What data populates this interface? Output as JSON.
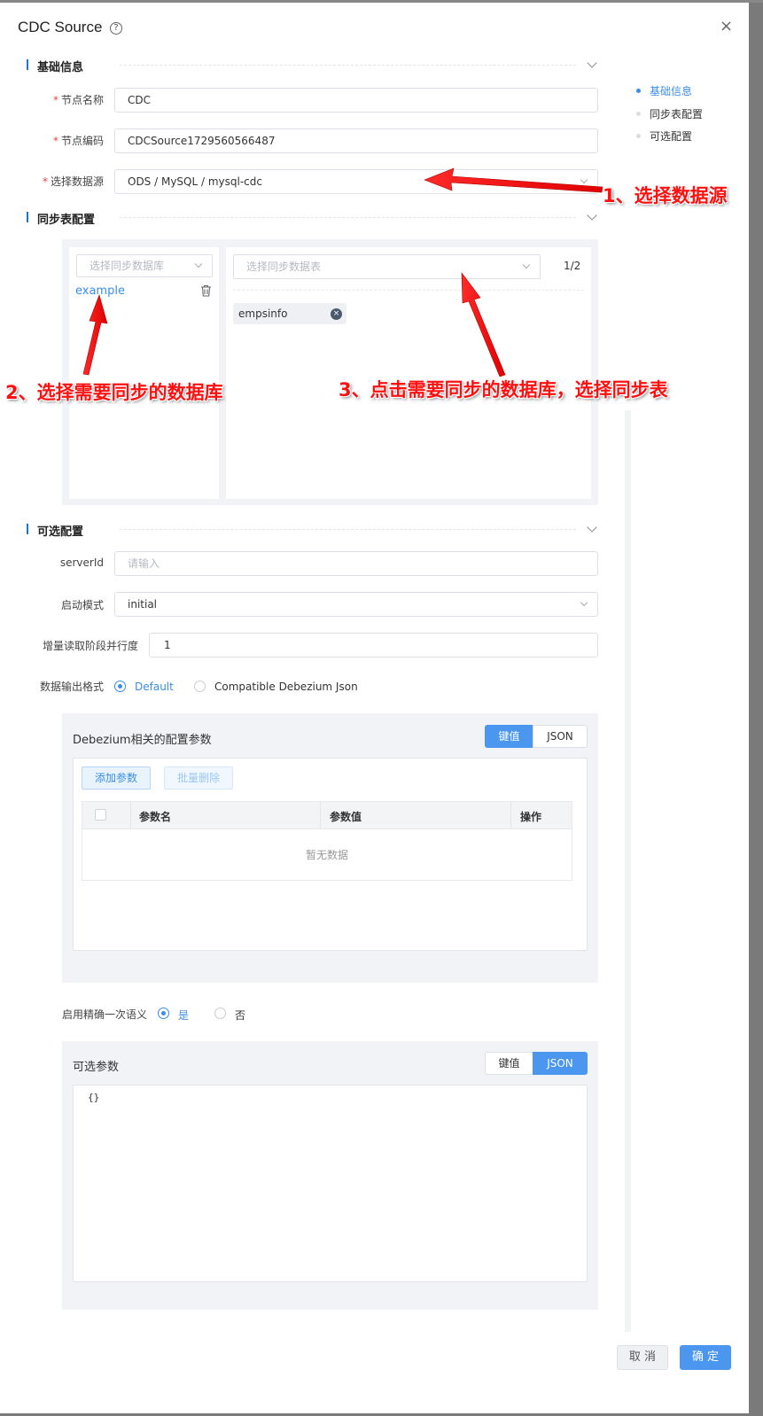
{
  "dialog": {
    "title": "CDC Source",
    "help_glyph": "?",
    "close_glyph": "×"
  },
  "sections": {
    "basic": "基础信息",
    "sync": "同步表配置",
    "optional": "可选配置"
  },
  "anchors": [
    "基础信息",
    "同步表配置",
    "可选配置"
  ],
  "basic": {
    "node_name_label": "节点名称",
    "node_name_value": "CDC",
    "node_code_label": "节点编码",
    "node_code_value": "CDCSource1729560566487",
    "datasource_label": "选择数据源",
    "datasource_value": "ODS / MySQL / mysql-cdc"
  },
  "sync": {
    "db_placeholder": "选择同步数据库",
    "db_item": "example",
    "table_placeholder": "选择同步数据表",
    "page": "1/2",
    "table_tag": "empsinfo",
    "tag_remove": "×"
  },
  "optional": {
    "serverid_label": "serverId",
    "serverid_placeholder": "请输入",
    "startup_label": "启动模式",
    "startup_value": "initial",
    "parallel_label": "增量读取阶段并行度",
    "parallel_value": "1",
    "format_label": "数据输出格式",
    "format_default": "Default",
    "format_compat": "Compatible Debezium Json",
    "debezium_title": "Debezium相关的配置参数",
    "seg_kv": "键值",
    "seg_json": "JSON",
    "add_param": "添加参数",
    "batch_delete": "批量删除",
    "col_name": "参数名",
    "col_value": "参数值",
    "col_op": "操作",
    "empty": "暂无数据",
    "exactly_once_label": "启用精确一次语义",
    "yes": "是",
    "no": "否",
    "params_title": "可选参数",
    "seg_kv2": "键值",
    "seg_json2": "JSON",
    "json_content": "{}"
  },
  "footer": {
    "cancel": "取 消",
    "ok": "确 定"
  },
  "annotations": {
    "step1": "1、选择数据源",
    "step2": "2、选择需要同步的数据库",
    "step3": "3、点击需要同步的数据库，选择同步表"
  },
  "colors": {
    "accent": "#3a8ee6",
    "required": "#e64646",
    "annotation": "#ff1010"
  }
}
